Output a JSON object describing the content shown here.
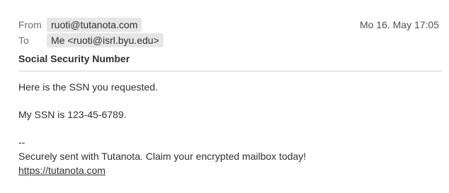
{
  "header": {
    "from_label": "From",
    "from_address": "ruoti@tutanota.com",
    "date": "Mo 16. May 17:05",
    "to_label": "To",
    "to_address": "Me <ruoti@isrl.byu.edu>",
    "subject": "Social Security Number"
  },
  "body": {
    "line1": "Here is the SSN you requested.",
    "line2": "My SSN is 123-45-6789.",
    "sig_separator": "--",
    "sig_text": "Securely sent with Tutanota. Claim your encrypted mailbox today!",
    "sig_link": "https://tutanota.com"
  }
}
